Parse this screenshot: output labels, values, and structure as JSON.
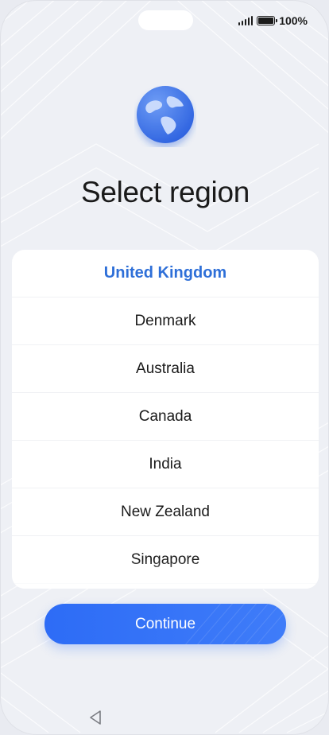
{
  "status_bar": {
    "battery_text": "100%",
    "signal_icon": "signal-icon",
    "battery_icon": "battery-icon"
  },
  "header": {
    "icon": "globe-icon",
    "title": "Select region"
  },
  "region_list": {
    "selected": "United Kingdom",
    "items": [
      "United Kingdom",
      "Denmark",
      "Australia",
      "Canada",
      "India",
      "New Zealand",
      "Singapore"
    ]
  },
  "actions": {
    "continue_label": "Continue"
  },
  "nav": {
    "back_icon": "back-triangle-icon"
  },
  "colors": {
    "accent": "#2e6fd8",
    "button": "#2d6cf6",
    "background": "#eef0f5"
  }
}
